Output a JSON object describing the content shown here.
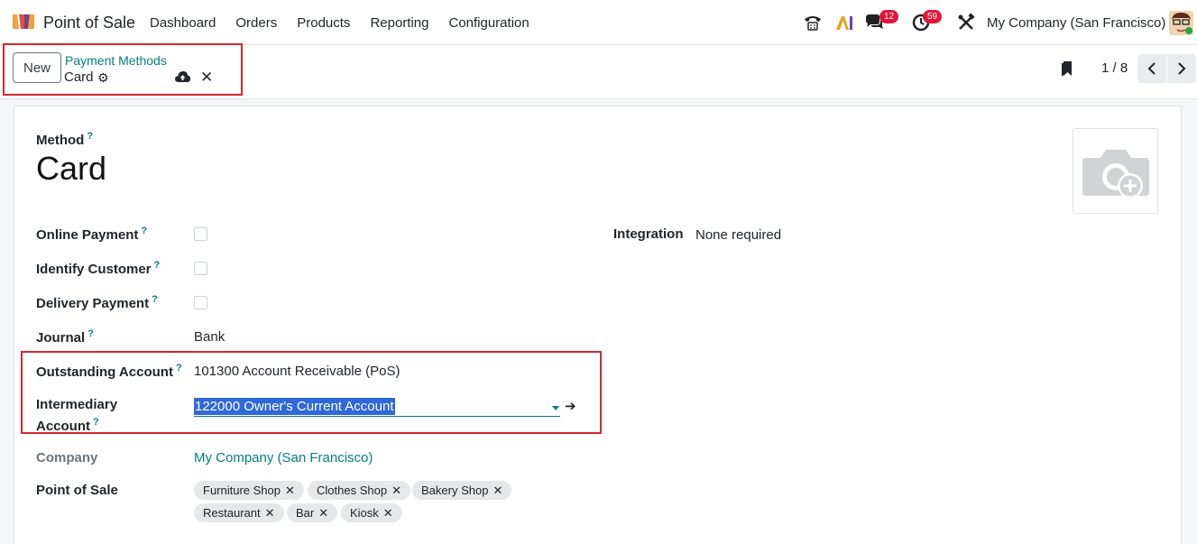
{
  "app": {
    "name": "Point of Sale"
  },
  "menu": [
    "Dashboard",
    "Orders",
    "Products",
    "Reporting",
    "Configuration"
  ],
  "systray": {
    "messages_count": "12",
    "activities_count": "59",
    "company": "My Company (San Francisco)"
  },
  "control": {
    "new_label": "New",
    "breadcrumb": "Payment Methods",
    "record_name": "Card",
    "pager": "1 / 8"
  },
  "form": {
    "method_label": "Method",
    "method_value": "Card",
    "online_payment_label": "Online Payment",
    "identify_customer_label": "Identify Customer",
    "delivery_payment_label": "Delivery Payment",
    "journal_label": "Journal",
    "journal_value": "Bank",
    "outstanding_label": "Outstanding Account",
    "outstanding_value": "101300 Account Receivable (PoS)",
    "intermediary_label_1": "Intermediary",
    "intermediary_label_2": "Account",
    "intermediary_value": "122000 Owner's Current Account",
    "company_label": "Company",
    "company_value": "My Company (San Francisco)",
    "pos_label": "Point of Sale",
    "pos_tags": [
      "Furniture Shop",
      "Clothes Shop",
      "Bakery Shop",
      "Restaurant",
      "Bar",
      "Kiosk"
    ],
    "integration_label": "Integration",
    "integration_value": "None required",
    "help_mark": "?"
  },
  "colors": {
    "accent": "#017e84",
    "highlight": "#d7262e",
    "badge": "#e4153b"
  }
}
